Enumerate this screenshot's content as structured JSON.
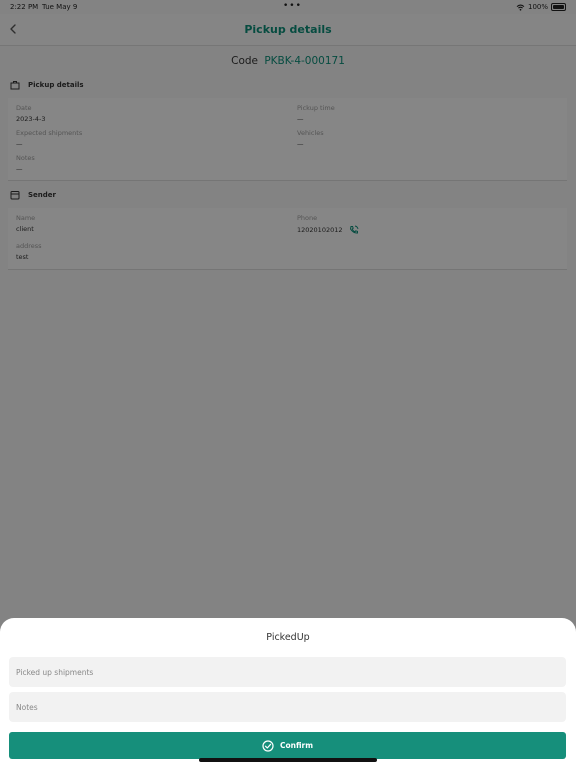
{
  "status_bar": {
    "time": "2:22 PM",
    "date": "Tue May 9",
    "dots": "•••",
    "battery": "100%"
  },
  "nav": {
    "title": "Pickup details"
  },
  "code": {
    "label": "Code",
    "value": "PKBK-4-000171"
  },
  "pickup_section": {
    "title": "Pickup details",
    "date_label": "Date",
    "date_value": "2023-4-3",
    "pickup_time_label": "Pickup time",
    "pickup_time_value": "—",
    "expected_shipments_label": "Expected shipments",
    "expected_shipments_value": "—",
    "vehicles_label": "Vehicles",
    "vehicles_value": "—",
    "notes_label": "Notes",
    "notes_value": "—"
  },
  "sender_section": {
    "title": "Sender",
    "name_label": "Name",
    "name_value": "client",
    "phone_label": "Phone",
    "phone_value": "12020102012",
    "address_label": "address",
    "address_value": "test"
  },
  "sheet": {
    "title": "PickedUp",
    "shipments_placeholder": "Picked up shipments",
    "notes_placeholder": "Notes",
    "confirm_label": "Confirm"
  },
  "colors": {
    "accent": "#0b8a76",
    "button": "#168f7b"
  }
}
